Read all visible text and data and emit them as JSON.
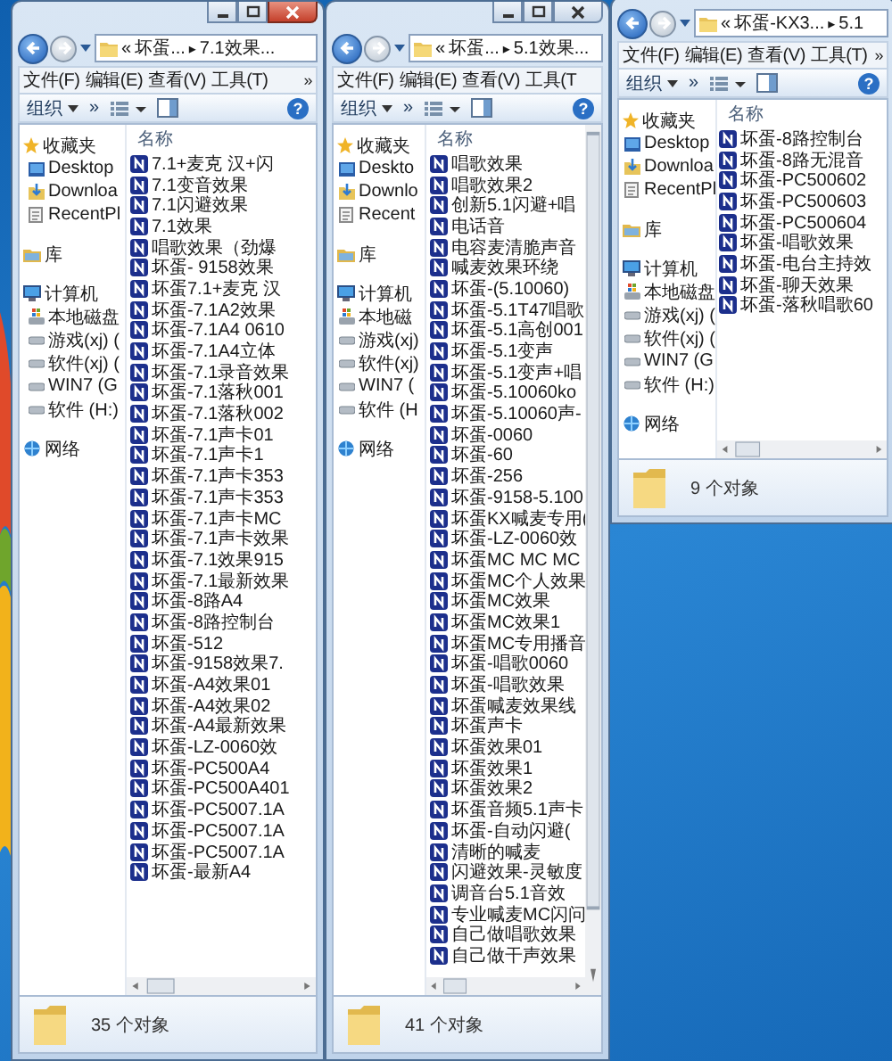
{
  "windows": [
    {
      "active": true,
      "title_buttons": true,
      "vertical_scrollbar": false,
      "address": {
        "overflow": "«",
        "parent": "坏蛋...",
        "separator": "▸",
        "current": "7.1效果..."
      },
      "menu": [
        "文件(F)",
        "编辑(E)",
        "查看(V)",
        "工具(T)"
      ],
      "menu_more": "»",
      "toolbar": {
        "organize": "组织",
        "more": "»",
        "help": "?"
      },
      "nav": [
        {
          "label": "收藏夹",
          "kind": "favorites",
          "items": [
            {
              "label": "Desktop",
              "kind": "desktop"
            },
            {
              "label": "Downloa",
              "kind": "downloads"
            },
            {
              "label": "RecentPl",
              "kind": "recent"
            }
          ]
        },
        {
          "label": "库",
          "kind": "libraries"
        },
        {
          "label": "计算机",
          "kind": "computer",
          "items": [
            {
              "label": "本地磁盘",
              "kind": "system-drive"
            },
            {
              "label": "游戏(xj) (",
              "kind": "drive"
            },
            {
              "label": "软件(xj) (",
              "kind": "drive"
            },
            {
              "label": "WIN7 (G",
              "kind": "drive"
            },
            {
              "label": "软件 (H:)",
              "kind": "drive"
            }
          ]
        },
        {
          "label": "网络",
          "kind": "network"
        }
      ],
      "column_header": "名称",
      "files": [
        "7.1+麦克 汉+闪",
        "7.1变音效果",
        "7.1闪避效果",
        "7.1效果",
        "唱歌效果（劲爆",
        "坏蛋- 9158效果",
        "坏蛋7.1+麦克 汉",
        "坏蛋-7.1A2效果",
        "坏蛋-7.1A4 0610",
        "坏蛋-7.1A4立体",
        "坏蛋-7.1录音效果",
        "坏蛋-7.1落秋001",
        "坏蛋-7.1落秋002",
        "坏蛋-7.1声卡01",
        "坏蛋-7.1声卡1",
        "坏蛋-7.1声卡353",
        "坏蛋-7.1声卡353",
        "坏蛋-7.1声卡MC",
        "坏蛋-7.1声卡效果",
        "坏蛋-7.1效果915",
        "坏蛋-7.1最新效果",
        "坏蛋-8路A4",
        "坏蛋-8路控制台",
        "坏蛋-512",
        "坏蛋-9158效果7.",
        "坏蛋-A4效果01",
        "坏蛋-A4效果02",
        "坏蛋-A4最新效果",
        "坏蛋-LZ-0060效",
        "坏蛋-PC500A4",
        "坏蛋-PC500A401",
        "坏蛋-PC5007.1A",
        "坏蛋-PC5007.1A",
        "坏蛋-PC5007.1A",
        "坏蛋-最新A4"
      ],
      "status": "35 个对象"
    },
    {
      "active": false,
      "title_buttons": true,
      "vertical_scrollbar": true,
      "address": {
        "overflow": "«",
        "parent": "坏蛋...",
        "separator": "▸",
        "current": "5.1效果..."
      },
      "menu": [
        "文件(F)",
        "编辑(E)",
        "查看(V)",
        "工具(T"
      ],
      "toolbar": {
        "organize": "组织",
        "more": "»",
        "help": "?"
      },
      "nav": [
        {
          "label": "收藏夹",
          "kind": "favorites",
          "items": [
            {
              "label": "Deskto",
              "kind": "desktop"
            },
            {
              "label": "Downlo",
              "kind": "downloads"
            },
            {
              "label": "Recent",
              "kind": "recent"
            }
          ]
        },
        {
          "label": "库",
          "kind": "libraries"
        },
        {
          "label": "计算机",
          "kind": "computer",
          "items": [
            {
              "label": "本地磁",
              "kind": "system-drive"
            },
            {
              "label": "游戏(xj)",
              "kind": "drive"
            },
            {
              "label": "软件(xj)",
              "kind": "drive"
            },
            {
              "label": "WIN7 (",
              "kind": "drive"
            },
            {
              "label": "软件 (H",
              "kind": "drive"
            }
          ]
        },
        {
          "label": "网络",
          "kind": "network"
        }
      ],
      "column_header": "名称",
      "files": [
        "唱歌效果",
        "唱歌效果2",
        "创新5.1闪避+唱",
        "电话音",
        "电容麦清脆声音",
        "喊麦效果环绕",
        "坏蛋-(5.10060)",
        "坏蛋-5.1T47唱歌",
        "坏蛋-5.1高创001",
        "坏蛋-5.1变声",
        "坏蛋-5.1变声+唱",
        "坏蛋-5.10060ko",
        "坏蛋-5.10060声-",
        "坏蛋-0060",
        "坏蛋-60",
        "坏蛋-256",
        "坏蛋-9158-5.100",
        "坏蛋KX喊麦专用(",
        "坏蛋-LZ-0060效",
        "坏蛋MC MC MC",
        "坏蛋MC个人效果",
        "坏蛋MC效果",
        "坏蛋MC效果1",
        "坏蛋MC专用播音",
        "坏蛋-唱歌0060",
        "坏蛋-唱歌效果",
        "坏蛋喊麦效果线",
        "坏蛋声卡",
        "坏蛋效果01",
        "坏蛋效果1",
        "坏蛋效果2",
        "坏蛋音频5.1声卡",
        "坏蛋-自动闪避(",
        "清晰的喊麦",
        "闪避效果-灵敏度",
        "调音台5.1音效",
        "专业喊麦MC闪问",
        "自己做唱歌效果",
        "自己做干声效果"
      ],
      "status": "41 个对象"
    },
    {
      "title_buttons": false,
      "vertical_scrollbar": false,
      "address": {
        "overflow": "«",
        "parent": "坏蛋-KX3...",
        "separator": "▸",
        "current": "5.1"
      },
      "menu": [
        "文件(F)",
        "编辑(E)",
        "查看(V)",
        "工具(T)"
      ],
      "menu_more": "»",
      "toolbar": {
        "organize": "组织",
        "more": "»",
        "help": "?"
      },
      "nav": [
        {
          "label": "收藏夹",
          "kind": "favorites",
          "items": [
            {
              "label": "Desktop",
              "kind": "desktop"
            },
            {
              "label": "Downloa",
              "kind": "downloads"
            },
            {
              "label": "RecentPl",
              "kind": "recent"
            }
          ]
        },
        {
          "label": "库",
          "kind": "libraries"
        },
        {
          "label": "计算机",
          "kind": "computer",
          "items": [
            {
              "label": "本地磁盘",
              "kind": "system-drive"
            },
            {
              "label": "游戏(xj) (",
              "kind": "drive"
            },
            {
              "label": "软件(xj) (",
              "kind": "drive"
            },
            {
              "label": "WIN7 (G",
              "kind": "drive"
            },
            {
              "label": "软件 (H:)",
              "kind": "drive"
            }
          ]
        },
        {
          "label": "网络",
          "kind": "network"
        }
      ],
      "column_header": "名称",
      "files": [
        "坏蛋-8路控制台",
        "坏蛋-8路无混音",
        "坏蛋-PC500602",
        "坏蛋-PC500603",
        "坏蛋-PC500604",
        "坏蛋-唱歌效果",
        "坏蛋-电台主持效",
        "坏蛋-聊天效果",
        "坏蛋-落秋唱歌60"
      ],
      "status": "9 个对象"
    }
  ]
}
